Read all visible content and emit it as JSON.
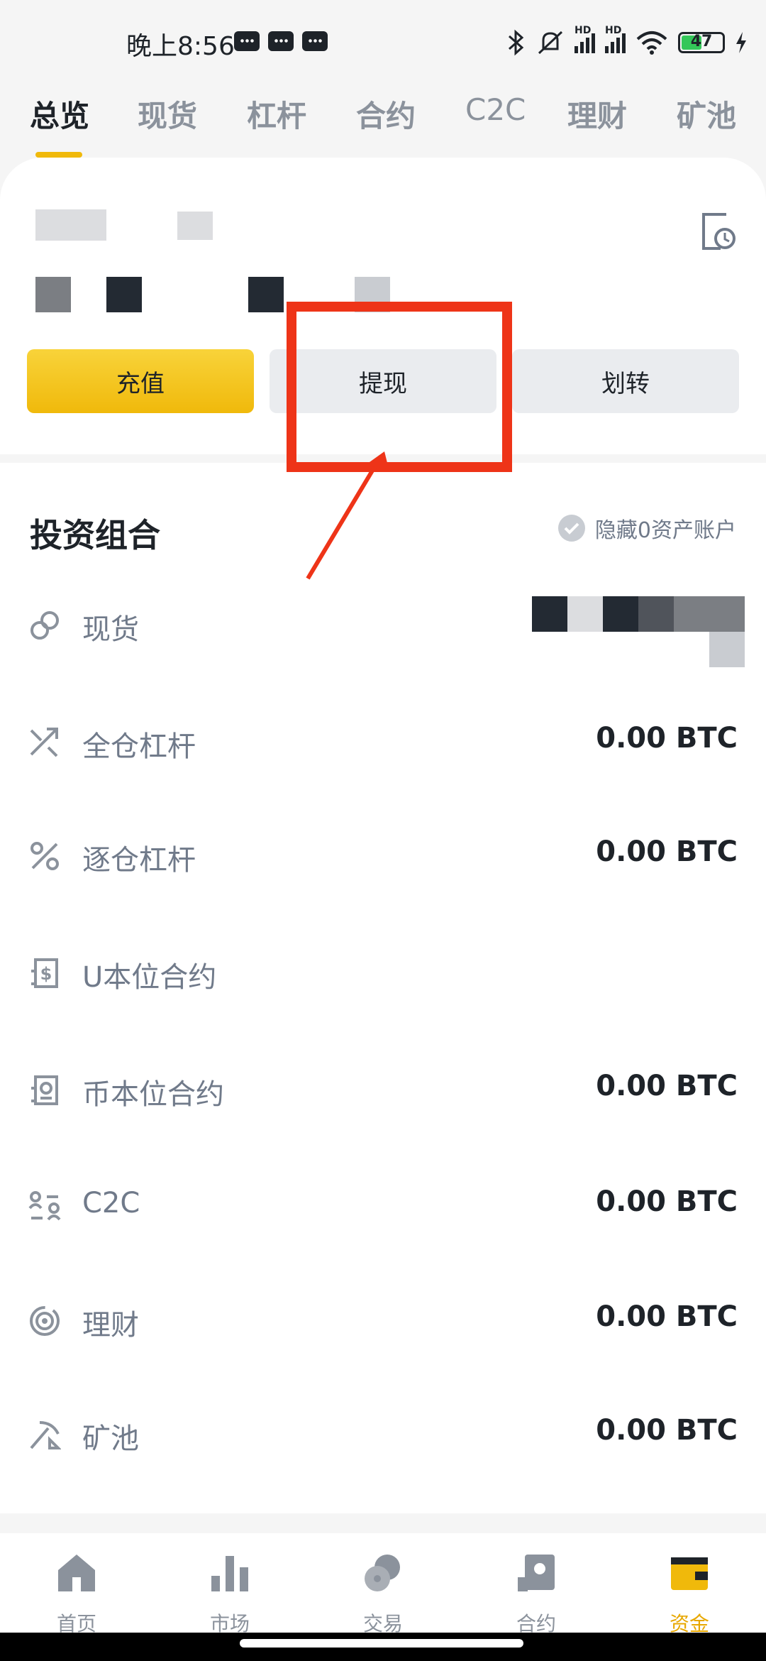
{
  "status_bar": {
    "time": "晚上8:56",
    "battery": "47"
  },
  "tabs": [
    "总览",
    "现货",
    "杠杆",
    "合约",
    "C2C",
    "理财",
    "矿池"
  ],
  "actions": {
    "deposit": "充值",
    "withdraw": "提现",
    "transfer": "划转"
  },
  "portfolio": {
    "title": "投资组合",
    "hide_zero": "隐藏0资产账户",
    "rows": [
      {
        "label": "现货",
        "value": "",
        "icon": "spot-icon"
      },
      {
        "label": "全仓杠杆",
        "value": "0.00 BTC",
        "icon": "cross-margin-icon"
      },
      {
        "label": "逐仓杠杆",
        "value": "0.00 BTC",
        "icon": "isolated-margin-icon"
      },
      {
        "label": "U本位合约",
        "value": "",
        "icon": "usdm-futures-icon"
      },
      {
        "label": "币本位合约",
        "value": "0.00 BTC",
        "icon": "coinm-futures-icon"
      },
      {
        "label": "C2C",
        "value": "0.00 BTC",
        "icon": "c2c-icon"
      },
      {
        "label": "理财",
        "value": "0.00 BTC",
        "icon": "earn-icon"
      },
      {
        "label": "矿池",
        "value": "0.00 BTC",
        "icon": "pool-icon"
      }
    ]
  },
  "bottom_nav": [
    "首页",
    "市场",
    "交易",
    "合约",
    "资金"
  ],
  "colors": {
    "accent": "#f0b90b",
    "annotation": "#ee3418",
    "text_primary": "#1e2329",
    "text_secondary": "#707a8a"
  }
}
